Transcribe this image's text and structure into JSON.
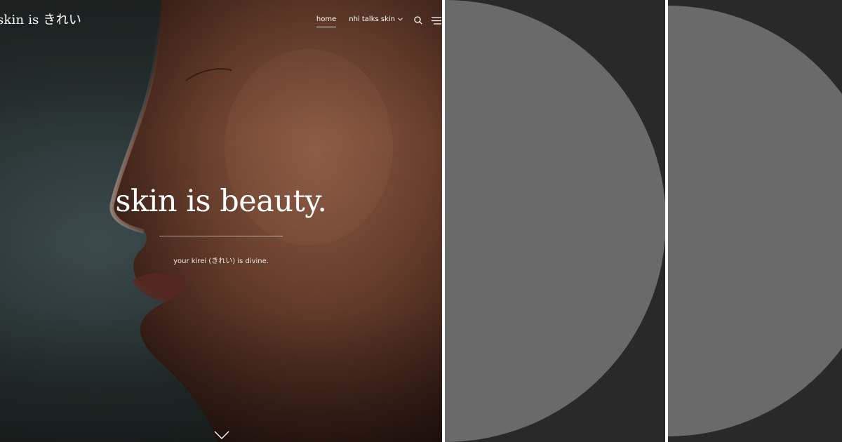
{
  "site": {
    "logo": "skin is きれい"
  },
  "nav": {
    "items": [
      {
        "label": "home"
      },
      {
        "label": "nhi talks skin"
      }
    ],
    "icons": {
      "dropdown": "chevron-down-icon",
      "search": "search-icon",
      "menu": "hamburger-menu-icon"
    }
  },
  "hero": {
    "title": "skin is beauty.",
    "subtitle": "your kirei (きれい) is divine.",
    "scroll_icon": "chevron-down-icon"
  },
  "colors": {
    "text": "#ffffff",
    "panel_background": "#292929",
    "panel_shape": "#6a6a6a"
  }
}
